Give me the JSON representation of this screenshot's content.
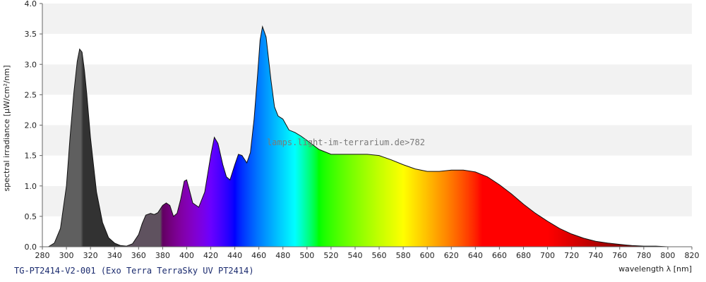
{
  "chart_data": {
    "type": "area",
    "ylabel": "spectral irradiance [µW/cm²/nm]",
    "xlabel": "wavelength λ [nm]",
    "xlim": [
      280,
      820
    ],
    "ylim": [
      0,
      4.0
    ],
    "x_ticks": [
      280,
      300,
      320,
      340,
      360,
      380,
      400,
      420,
      440,
      460,
      480,
      500,
      520,
      540,
      560,
      580,
      600,
      620,
      640,
      660,
      680,
      700,
      720,
      740,
      760,
      780,
      800,
      820
    ],
    "y_ticks": [
      "0.0",
      "0.5",
      "1.0",
      "1.5",
      "2.0",
      "2.5",
      "3.0",
      "3.5",
      "4.0"
    ],
    "grid": "horizontal bands",
    "watermark": "lamps.light-im-terrarium.de>782",
    "series": [
      {
        "x": [
          285,
          290,
          295,
          300,
          303,
          306,
          309,
          311,
          313,
          315,
          317,
          320,
          325,
          330,
          335,
          340,
          345,
          350,
          355,
          360,
          363,
          366,
          370,
          373,
          376,
          380,
          383,
          386,
          389,
          392,
          395,
          398,
          400,
          402,
          405,
          410,
          415,
          420,
          423,
          426,
          430,
          433,
          436,
          440,
          443,
          446,
          450,
          453,
          456,
          459,
          461,
          463,
          466,
          470,
          473,
          476,
          480,
          485,
          490,
          495,
          500,
          510,
          520,
          530,
          540,
          550,
          560,
          570,
          580,
          590,
          600,
          610,
          620,
          630,
          640,
          650,
          660,
          670,
          680,
          690,
          700,
          710,
          720,
          730,
          740,
          750,
          760,
          770,
          780,
          790,
          800,
          810
        ],
        "y": [
          0.0,
          0.06,
          0.3,
          1.0,
          1.8,
          2.5,
          3.05,
          3.25,
          3.2,
          2.9,
          2.5,
          1.8,
          0.9,
          0.4,
          0.15,
          0.06,
          0.02,
          0.01,
          0.05,
          0.2,
          0.38,
          0.52,
          0.55,
          0.53,
          0.56,
          0.68,
          0.72,
          0.68,
          0.5,
          0.55,
          0.78,
          1.08,
          1.1,
          0.95,
          0.72,
          0.65,
          0.9,
          1.5,
          1.8,
          1.7,
          1.35,
          1.15,
          1.1,
          1.35,
          1.52,
          1.5,
          1.38,
          1.55,
          2.1,
          2.85,
          3.4,
          3.62,
          3.45,
          2.75,
          2.3,
          2.15,
          2.1,
          1.92,
          1.88,
          1.82,
          1.75,
          1.6,
          1.52,
          1.52,
          1.52,
          1.52,
          1.5,
          1.43,
          1.35,
          1.28,
          1.24,
          1.24,
          1.26,
          1.26,
          1.23,
          1.15,
          1.02,
          0.87,
          0.7,
          0.55,
          0.42,
          0.3,
          0.21,
          0.14,
          0.09,
          0.06,
          0.04,
          0.02,
          0.01,
          0.01,
          0.0,
          0.0
        ]
      }
    ]
  },
  "footer": {
    "caption": "TG-PT2414-V2-001 (Exo Terra TerraSky UV PT2414)"
  }
}
